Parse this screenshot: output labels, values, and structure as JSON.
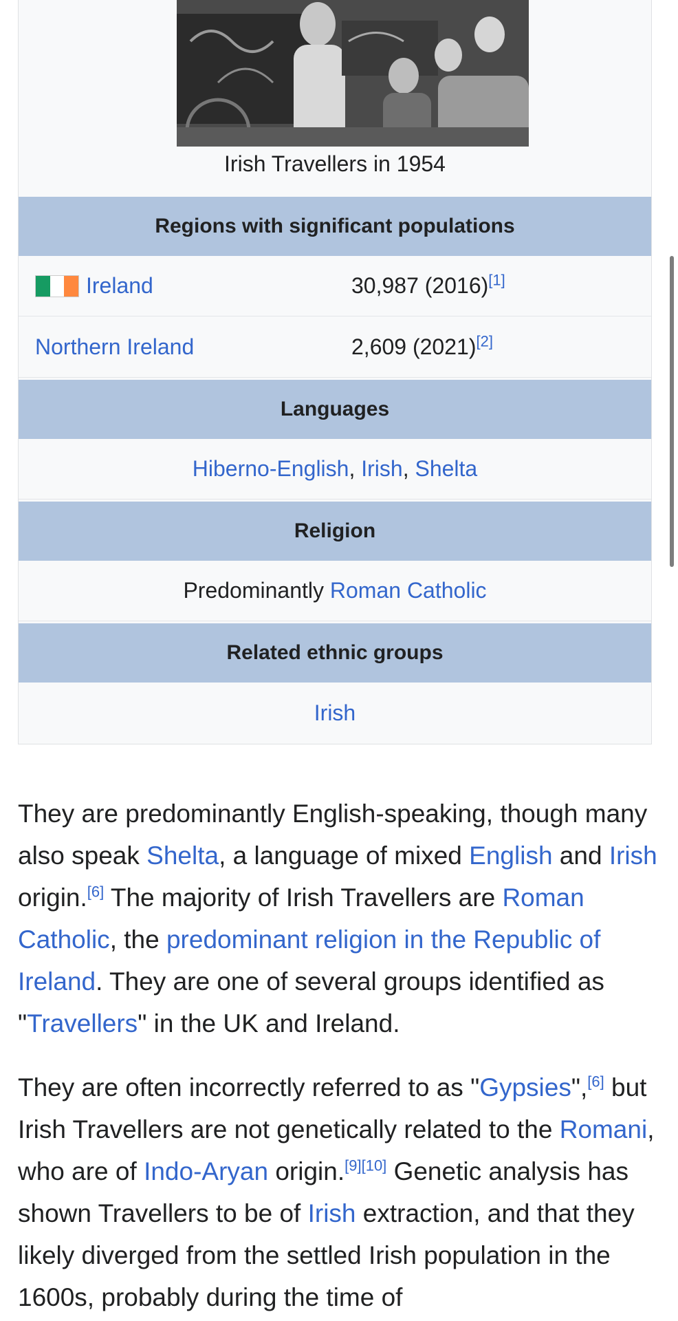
{
  "infobox": {
    "caption": "Irish Travellers in 1954",
    "regions_header": "Regions with significant populations",
    "regions": [
      {
        "name": "Ireland",
        "population": "30,987 (2016)",
        "ref": "[1]"
      },
      {
        "name": "Northern Ireland",
        "population": "2,609 (2021)",
        "ref": "[2]"
      }
    ],
    "languages_header": "Languages",
    "languages": [
      "Hiberno-English",
      "Irish",
      "Shelta"
    ],
    "language_sep": ", ",
    "religion_header": "Religion",
    "religion_prefix": "Predominantly ",
    "religion_link": "Roman Catholic",
    "related_header": "Related ethnic groups",
    "related": "Irish",
    "flag_colors": [
      "#169b62",
      "#ffffff",
      "#ff883e"
    ]
  },
  "paragraph1": [
    {
      "t": "They are predominantly English-speaking, though many also speak "
    },
    {
      "t": "Shelta",
      "link": true
    },
    {
      "t": ", a language of mixed "
    },
    {
      "t": "English",
      "link": true
    },
    {
      "t": " and "
    },
    {
      "t": "Irish",
      "link": true
    },
    {
      "t": " origin."
    },
    {
      "t": "[6]",
      "sup": true
    },
    {
      "t": " The majority of Irish Travellers are "
    },
    {
      "t": "Roman Catholic",
      "link": true
    },
    {
      "t": ", the "
    },
    {
      "t": "predominant religion in the Republic of Ireland",
      "link": true
    },
    {
      "t": ". They are one of several groups identified as \""
    },
    {
      "t": "Travellers",
      "link": true
    },
    {
      "t": "\" in the UK and Ireland."
    }
  ],
  "paragraph2": [
    {
      "t": "They are often incorrectly referred to as \""
    },
    {
      "t": "Gypsies",
      "link": true
    },
    {
      "t": "\","
    },
    {
      "t": "[6]",
      "sup": true
    },
    {
      "t": " but Irish Travellers are not genetically related to the "
    },
    {
      "t": "Romani",
      "link": true
    },
    {
      "t": ", who are of "
    },
    {
      "t": "Indo-Aryan",
      "link": true
    },
    {
      "t": " origin."
    },
    {
      "t": "[9]",
      "sup": true
    },
    {
      "t": "[10]",
      "sup": true
    },
    {
      "t": " Genetic analysis has shown Travellers to be of "
    },
    {
      "t": "Irish",
      "link": true
    },
    {
      "t": " extraction, and that they likely diverged from the settled Irish population in the 1600s, probably during the time of"
    }
  ]
}
